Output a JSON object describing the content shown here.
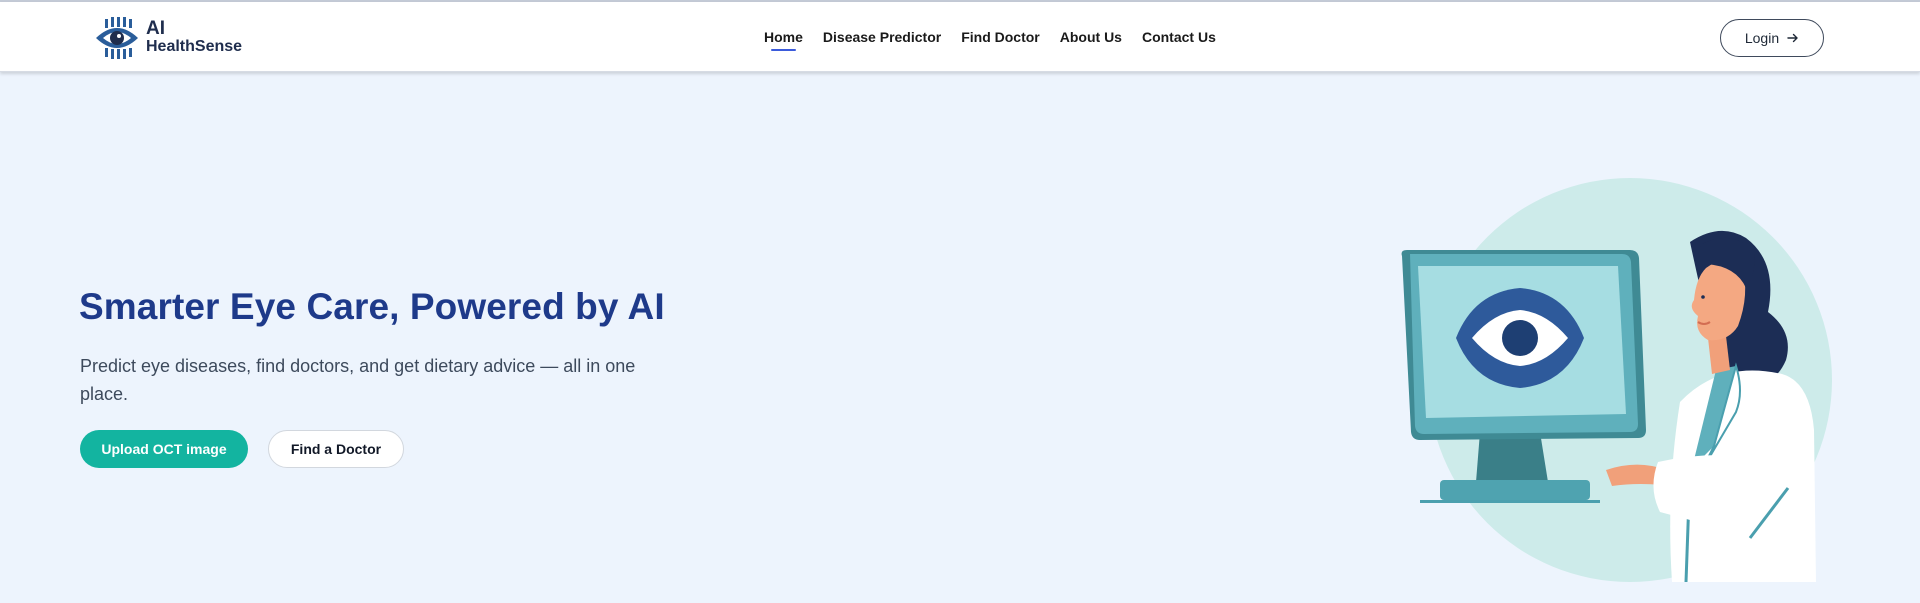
{
  "brand": {
    "line1": "AI",
    "line2": "HealthSense",
    "logo_icon": "eye-circuit-icon"
  },
  "nav": {
    "items": [
      {
        "label": "Home",
        "active": true
      },
      {
        "label": "Disease Predictor",
        "active": false
      },
      {
        "label": "Find Doctor",
        "active": false
      },
      {
        "label": "About Us",
        "active": false
      },
      {
        "label": "Contact Us",
        "active": false
      }
    ]
  },
  "header": {
    "login_label": "Login",
    "login_icon": "arrow-right-icon"
  },
  "hero": {
    "title": "Smarter Eye Care, Powered by AI",
    "subtitle": "Predict eye diseases, find doctors, and get dietary advice — all in one place.",
    "primary_button": "Upload OCT image",
    "secondary_button": "Find a Doctor",
    "illustration": "doctor-at-computer-eye-scan"
  },
  "colors": {
    "page_background": "#edf4fd",
    "title": "#1e3a8a",
    "primary_button": "#13b4a0",
    "nav_active_underline": "#3b5bdb",
    "brand_blue": "#2a5d9a"
  }
}
